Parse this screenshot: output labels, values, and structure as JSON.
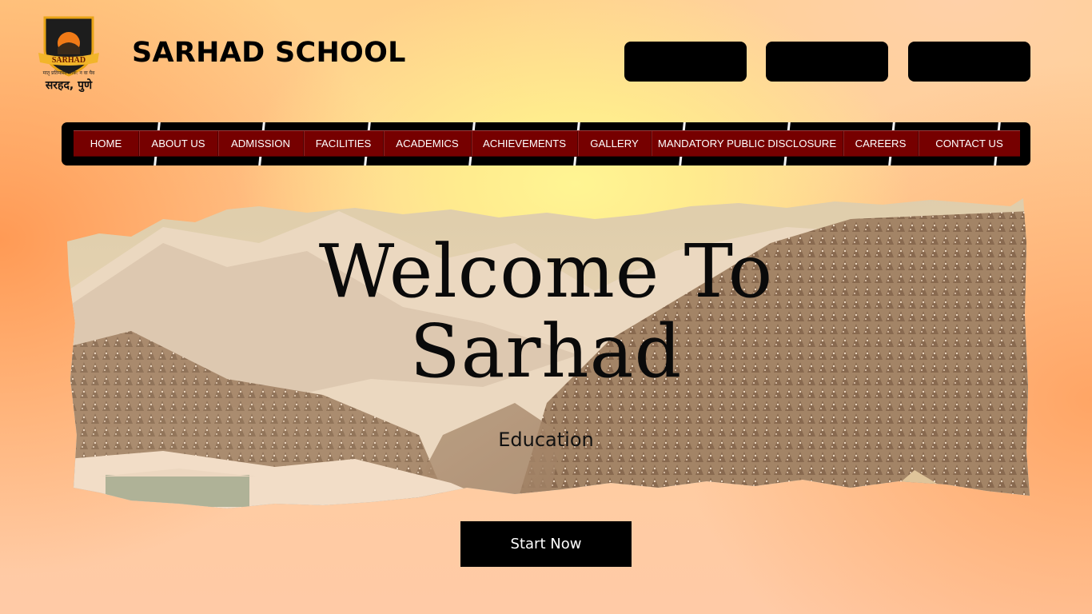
{
  "header": {
    "logo_text": "SARHAD",
    "logo_motto": "मातृ प्रतिमास्य लोक: न वा यैव",
    "logo_city": "सरहद, पुणे",
    "title": "SARHAD SCHOOL",
    "buttons": [
      "",
      "",
      ""
    ]
  },
  "nav": {
    "items": [
      "HOME",
      "ABOUT US",
      "ADMISSION",
      "FACILITIES",
      "ACADEMICS",
      "ACHIEVEMENTS",
      "GALLERY",
      "MANDATORY PUBLIC DISCLOSURE",
      "CAREERS",
      "CONTACT US"
    ]
  },
  "hero": {
    "title_line1": "Welcome To",
    "title_line2": "Sarhad",
    "subtitle": "Education",
    "cta_label": "Start Now",
    "image": "snowy-mountain-forest-landscape"
  },
  "colors": {
    "nav_bar": "#760000",
    "frame": "#000000",
    "background_warm": "#ffcf9c",
    "background_glow": "#fff593"
  }
}
